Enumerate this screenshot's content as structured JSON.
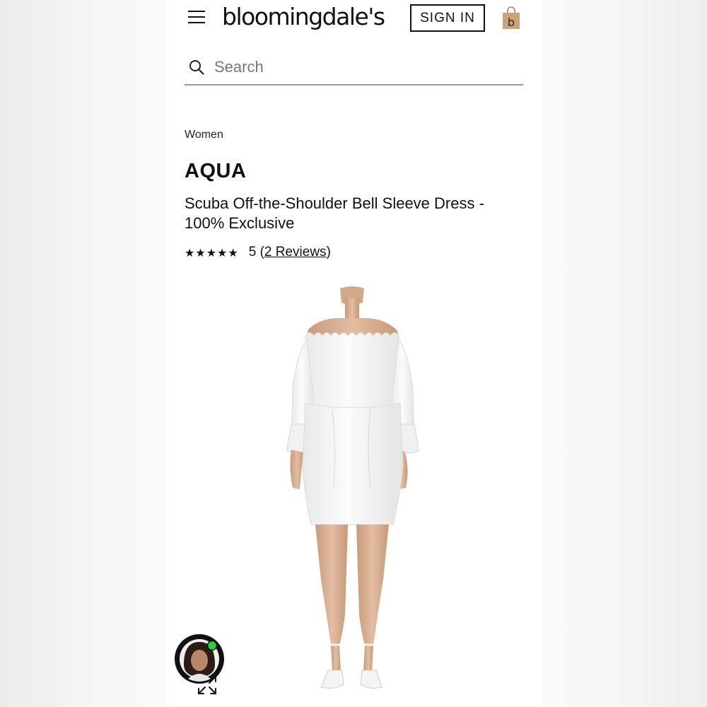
{
  "header": {
    "logo_text": "bloomingdale's",
    "sign_in_label": "SIGN IN",
    "menu_icon": "hamburger-menu-icon",
    "bag_icon": "shopping-bag-icon",
    "bag_letter": "b"
  },
  "search": {
    "placeholder": "Search",
    "icon": "search-icon"
  },
  "breadcrumb": "Women",
  "product": {
    "brand": "AQUA",
    "title": "Scuba Off-the-Shoulder Bell Sleeve Dress - 100% Exclusive",
    "stars": "★★★★★",
    "rating_value": "5 (",
    "reviews_label": "2 Reviews",
    "reviews_close": ")",
    "rating": 5,
    "image_alt": "white off-the-shoulder bell sleeve dress on model"
  },
  "chat": {
    "icon": "chat-agent-avatar-icon",
    "status_color": "#2ecc40",
    "expand_icon": "expand-arrows-icon"
  },
  "colors": {
    "bag": "#c9a47a",
    "text": "#111111",
    "search_border": "#999999"
  }
}
